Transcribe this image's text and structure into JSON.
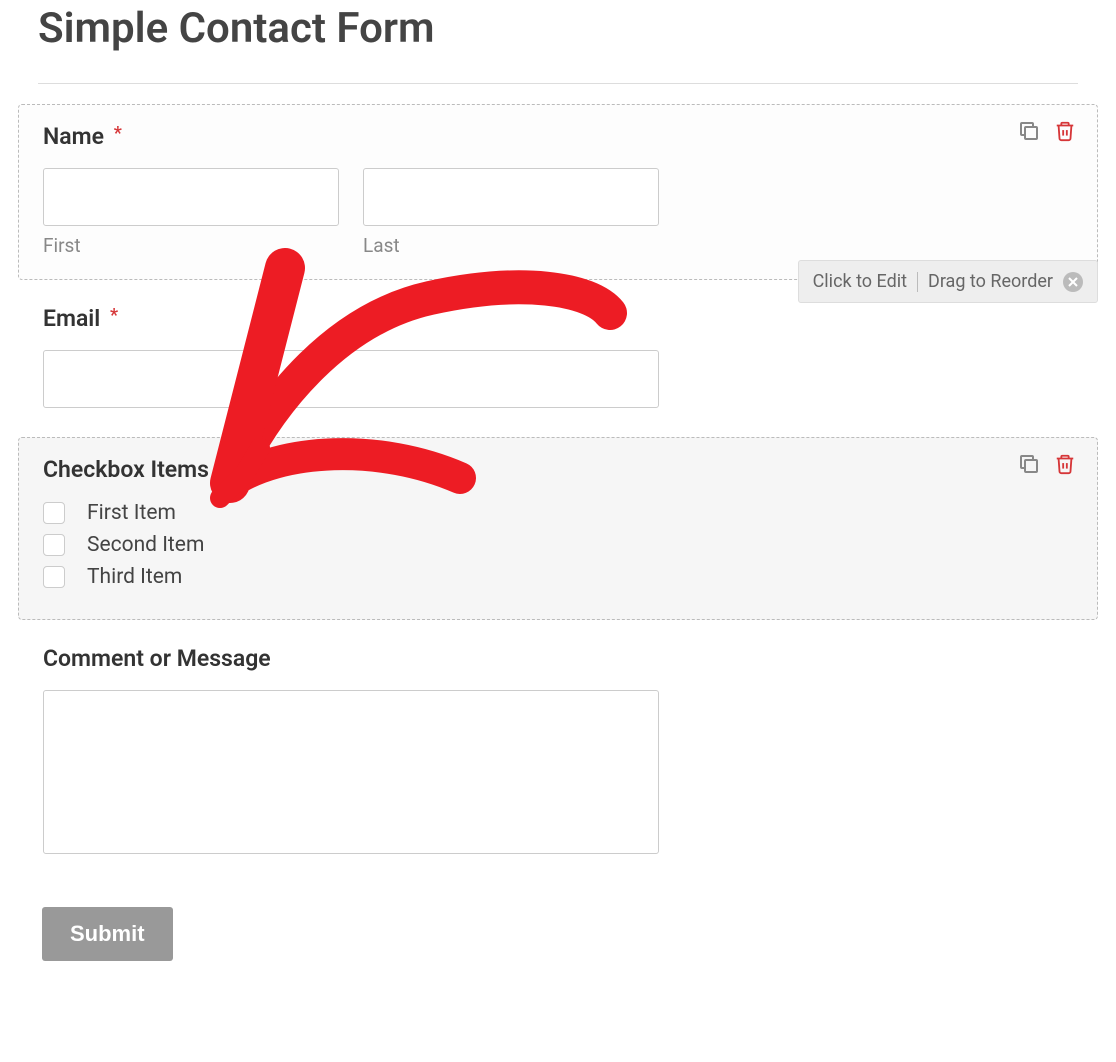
{
  "form_title": "Simple Contact Form",
  "fields": {
    "name": {
      "label": "Name",
      "required": true,
      "first_sublabel": "First",
      "last_sublabel": "Last"
    },
    "email": {
      "label": "Email",
      "required": true
    },
    "checkbox": {
      "label": "Checkbox Items",
      "items": [
        "First Item",
        "Second Item",
        "Third Item"
      ]
    },
    "comment": {
      "label": "Comment or Message"
    }
  },
  "tooltip": {
    "edit_text": "Click to Edit",
    "drag_text": "Drag to Reorder"
  },
  "submit_label": "Submit"
}
